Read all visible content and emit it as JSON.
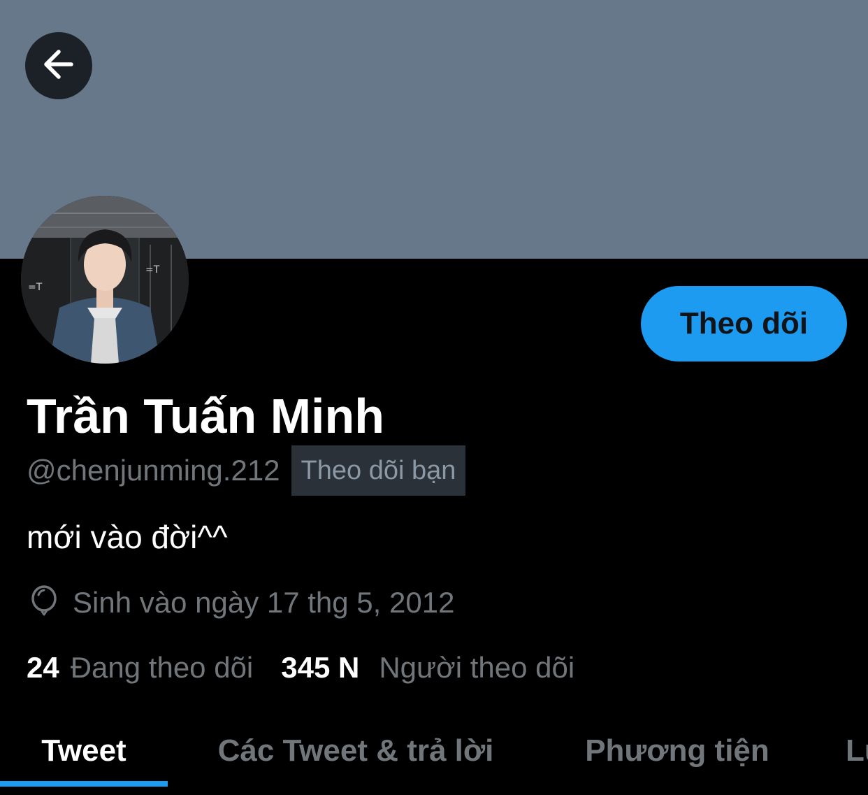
{
  "profile": {
    "display_name": "Trần Tuấn Minh",
    "handle": "@chenjunming.212",
    "follows_you_label": "Theo dõi bạn",
    "bio": "mới vào đời^^",
    "birth_date": "Sinh vào ngày 17 thg 5, 2012"
  },
  "actions": {
    "follow_label": "Theo dõi"
  },
  "stats": {
    "following_count": "24",
    "following_label": "Đang theo dõi",
    "followers_count": "345 N",
    "followers_label": "Người theo dõi"
  },
  "tabs": [
    {
      "label": "Tweet",
      "active": true
    },
    {
      "label": "Các Tweet & trả lời",
      "active": false
    },
    {
      "label": "Phương tiện",
      "active": false
    },
    {
      "label": "Lu",
      "active": false
    }
  ],
  "colors": {
    "banner": "#66788a",
    "accent": "#1d9bf0",
    "secondary_text": "#71767b",
    "background": "#000000"
  },
  "icons": {
    "back": "arrow-left-icon",
    "birth": "balloon-icon"
  }
}
